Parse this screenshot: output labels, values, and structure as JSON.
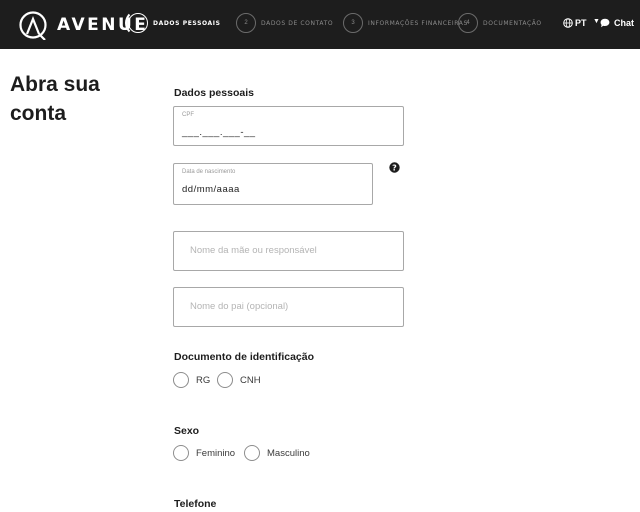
{
  "header": {
    "brand": "AVENUE",
    "steps": [
      {
        "number": "1",
        "label": "DADOS PESSOAIS",
        "active": true
      },
      {
        "number": "2",
        "label": "DADOS DE CONTATO",
        "active": false
      },
      {
        "number": "3",
        "label": "INFORMAÇÕES FINANCEIRAS",
        "active": false
      },
      {
        "number": "4",
        "label": "DOCUMENTAÇÃO",
        "active": false
      }
    ],
    "language": "PT",
    "chat_label": "Chat"
  },
  "page": {
    "title": "Abra sua conta"
  },
  "form": {
    "personal_section": "Dados pessoais",
    "cpf": {
      "label": "CPF",
      "value": "___.___.___-__"
    },
    "birthdate": {
      "label": "Data de nascimento",
      "value": "dd/mm/aaaa"
    },
    "mother_name": {
      "placeholder": "Nome da mãe ou responsável"
    },
    "father_name": {
      "placeholder": "Nome do pai (opcional)"
    },
    "id_document": {
      "label": "Documento de identificação",
      "options": [
        "RG",
        "CNH"
      ]
    },
    "sex": {
      "label": "Sexo",
      "options": [
        "Feminino",
        "Masculino"
      ]
    },
    "phone_label": "Telefone"
  },
  "icons": {
    "help": "question-circle-icon",
    "globe": "globe-icon",
    "chat": "chat-bubble-icon"
  },
  "colors": {
    "header_bg": "#1d1d1d",
    "accent": "#ffffff"
  }
}
